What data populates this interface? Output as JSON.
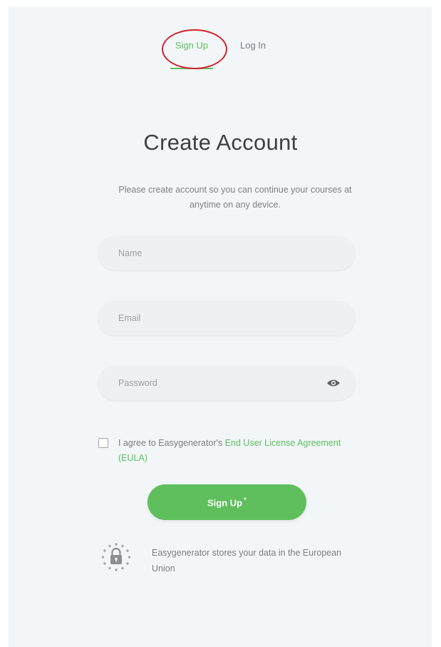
{
  "tabs": {
    "signup": "Sign Up",
    "login": "Log In"
  },
  "title": "Create Account",
  "subtitle": "Please create account so you can continue your courses at anytime on any device.",
  "fields": {
    "name": {
      "placeholder": "Name",
      "value": ""
    },
    "email": {
      "placeholder": "Email",
      "value": ""
    },
    "password": {
      "placeholder": "Password",
      "value": ""
    }
  },
  "agreement": {
    "prefix": "I agree to Easygenerator's ",
    "link": "End User License Agreement (EULA)",
    "checked": false
  },
  "signup_button": {
    "label": "Sign Up",
    "asterisk": "*"
  },
  "storage_note": "Easygenerator stores your data in the European Union",
  "colors": {
    "accent": "#5fbf5c",
    "annotation": "#d3222a",
    "background": "#f2f6f9"
  },
  "icons": {
    "password_toggle": "eye-icon",
    "data_storage": "eu-lock-icon"
  }
}
